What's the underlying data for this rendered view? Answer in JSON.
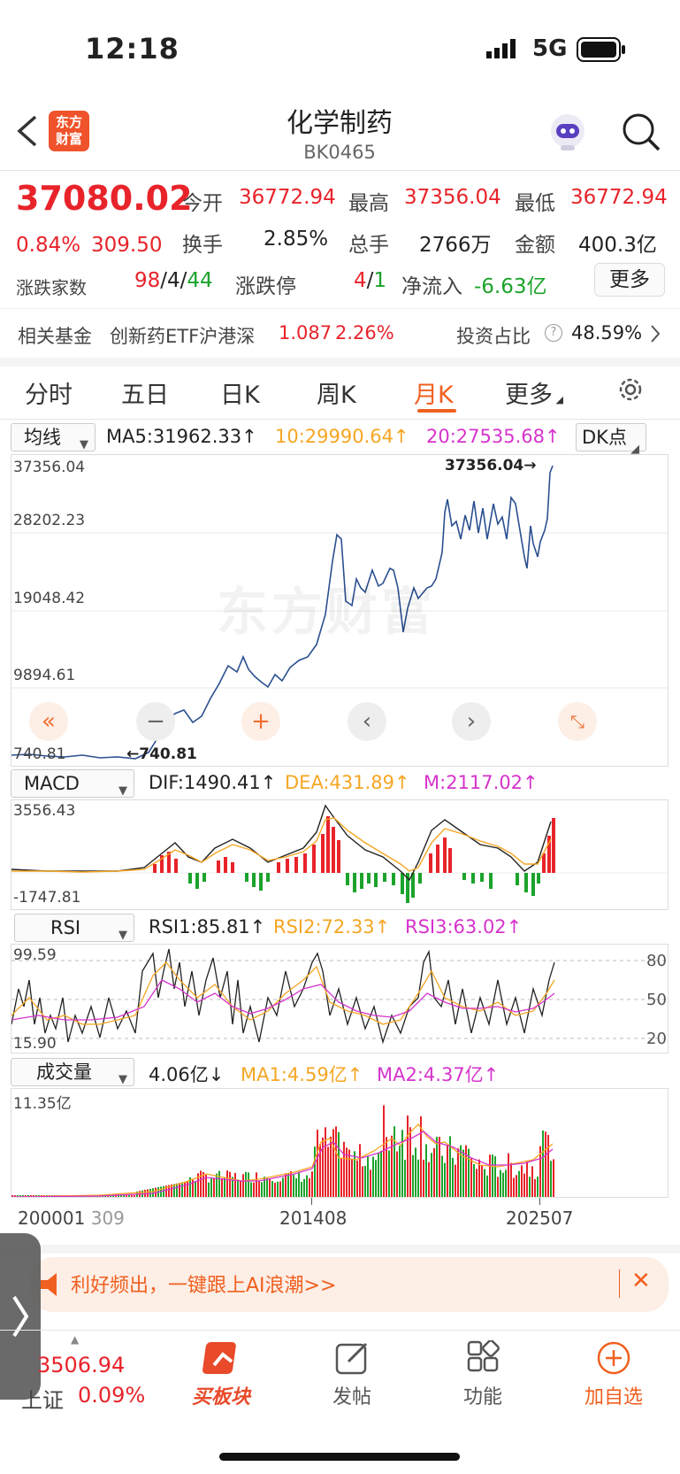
{
  "status": {
    "time": "12:18",
    "network": "5G"
  },
  "header": {
    "title": "化学制药",
    "code": "BK0465",
    "logo_line1": "东方",
    "logo_line2": "财富"
  },
  "quote": {
    "price": "37080.02",
    "change_pct": "0.84%",
    "change": "309.50",
    "open_label": "今开",
    "open": "36772.94",
    "high_label": "最高",
    "high": "37356.04",
    "low_label": "最低",
    "low": "36772.94",
    "turnover_label": "换手",
    "turnover": "2.85%",
    "volume_label": "总手",
    "volume": "2766万",
    "amount_label": "金额",
    "amount": "400.3亿",
    "updown_label": "涨跌家数",
    "up_count": "98",
    "flat_count": "4",
    "down_count": "44",
    "sep": "/",
    "limit_label": "涨跌停",
    "limit_up": "4",
    "limit_down": "1",
    "netflow_label": "净流入",
    "netflow": "-6.63亿",
    "more_label": "更多"
  },
  "fund": {
    "label": "相关基金",
    "name": "创新药ETF沪港深",
    "price": "1.087",
    "pct": "2.26%",
    "ratio_label": "投资占比",
    "ratio": "48.59%"
  },
  "tabs": [
    {
      "label": "分时"
    },
    {
      "label": "五日"
    },
    {
      "label": "日K"
    },
    {
      "label": "周K"
    },
    {
      "label": "月K"
    },
    {
      "label": "更多"
    }
  ],
  "ma_bar": {
    "select": "均线",
    "ma5": "MA5:31962.33↑",
    "ma10": "10:29990.64↑",
    "ma20": "20:27535.68↑",
    "dk": "DK点"
  },
  "kline": {
    "y1": "37356.04",
    "y2": "28202.23",
    "y3": "19048.42",
    "y4": "9894.61",
    "y5": "740.81",
    "high_tag": "37356.04",
    "low_tag": "740.81",
    "watermark": "东方财富"
  },
  "macd_bar": {
    "select": "MACD",
    "dif": "DIF:1490.41↑",
    "dea": "DEA:431.89↑",
    "m": "M:2117.02↑",
    "top": "3556.43",
    "bottom": "-1747.81"
  },
  "rsi_bar": {
    "select": "RSI",
    "rsi1": "RSI1:85.81↑",
    "rsi2": "RSI2:72.33↑",
    "rsi3": "RSI3:63.02↑",
    "top": "99.59",
    "bottom": "15.90",
    "r80": "80",
    "r50": "50",
    "r20": "20"
  },
  "vol_bar": {
    "select": "成交量",
    "vol": "4.06亿↓",
    "ma1": "MA1:4.59亿↑",
    "ma2": "MA2:4.37亿↑",
    "top": "11.35亿"
  },
  "x_axis": {
    "start": "200001",
    "start_suffix": "309",
    "mid": "201408",
    "end": "202507"
  },
  "banner": {
    "text": "利好频出，一键跟上AI浪潮>>"
  },
  "bottom_nav": {
    "index_value": "3506.94",
    "index_name": "上证",
    "index_pct": "0.09%",
    "buy": "买板块",
    "post": "发帖",
    "func": "功能",
    "add": "加自选"
  },
  "colors": {
    "accent": "#f06020",
    "up": "#e8232a",
    "down": "#1ba32b",
    "line": "#2a4f8f",
    "ma10": "#f5a623",
    "ma20": "#d633cc"
  }
}
